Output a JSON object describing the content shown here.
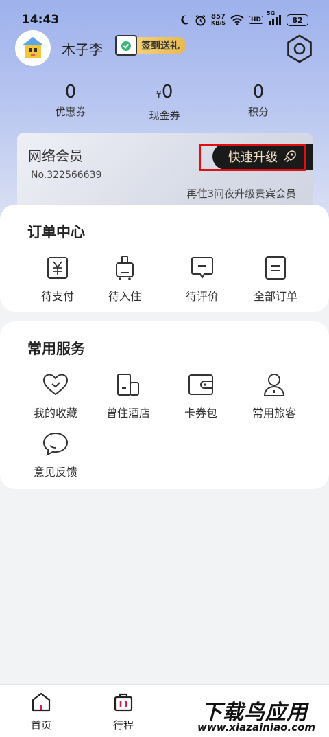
{
  "status_bar": {
    "time": "14:43",
    "net_speed_value": "857",
    "net_speed_unit": "KB/S",
    "hd": "HD",
    "signal": "5G",
    "battery": "82"
  },
  "profile": {
    "username": "木子李",
    "signin_label": "签到送礼"
  },
  "stats": [
    {
      "value": "0",
      "prefix": "",
      "label": "优惠券"
    },
    {
      "value": "0",
      "prefix": "¥",
      "label": "现金券"
    },
    {
      "value": "0",
      "prefix": "",
      "label": "积分"
    }
  ],
  "member": {
    "title": "网络会员",
    "number": "No.322566639",
    "upgrade_label": "快速升级",
    "hint": "再住3间夜升级贵宾会员"
  },
  "orders": {
    "title": "订单中心",
    "items": [
      {
        "label": "待支付",
        "icon": "yen-icon"
      },
      {
        "label": "待入住",
        "icon": "luggage-icon"
      },
      {
        "label": "待评价",
        "icon": "comment-icon"
      },
      {
        "label": "全部订单",
        "icon": "order-list-icon"
      }
    ]
  },
  "services": {
    "title": "常用服务",
    "items": [
      {
        "label": "我的收藏",
        "icon": "heart-icon"
      },
      {
        "label": "曾住酒店",
        "icon": "hotel-icon"
      },
      {
        "label": "卡券包",
        "icon": "wallet-icon"
      },
      {
        "label": "常用旅客",
        "icon": "person-icon"
      },
      {
        "label": "意见反馈",
        "icon": "feedback-icon"
      }
    ]
  },
  "tabs": [
    {
      "label": "首页",
      "icon": "home-icon"
    },
    {
      "label": "行程",
      "icon": "suitcase-icon"
    }
  ],
  "watermark": {
    "title": "下载鸟应用",
    "url": "www.xiazainiao.com"
  }
}
